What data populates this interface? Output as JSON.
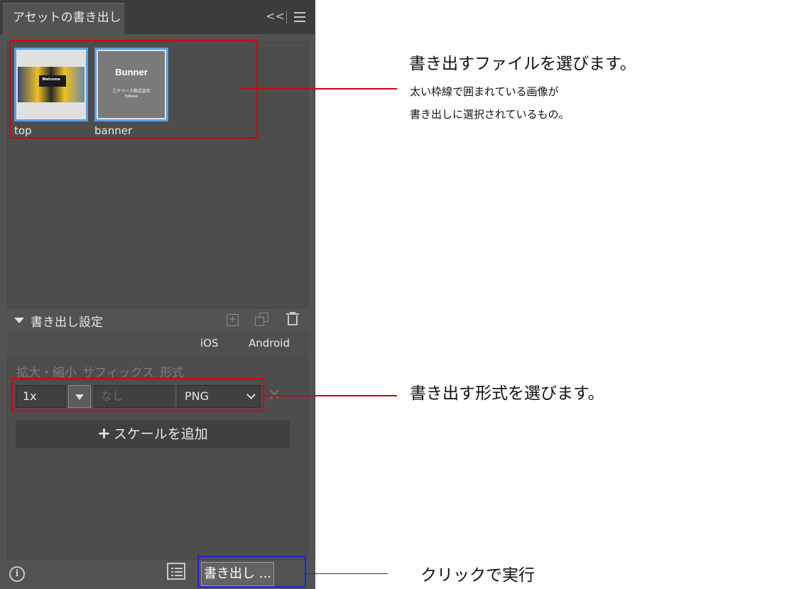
{
  "panel": {
    "tab_title": "アセットの書き出し",
    "collapse_icon": "<<"
  },
  "assets": [
    {
      "label": "top",
      "thumb_text": "Welcome"
    },
    {
      "label": "banner",
      "thumb_title": "Bunner",
      "thumb_sub1": "エドベース株式会社",
      "thumb_sub2": "Edbase"
    }
  ],
  "export_settings": {
    "title": "書き出し設定",
    "tabs": [
      "iOS",
      "Android"
    ],
    "column_headers": [
      "拡大・縮小",
      "サフィックス",
      "形式"
    ],
    "scale_value": "1x",
    "suffix_placeholder": "なし",
    "format_value": "PNG",
    "add_scale_label": "スケールを追加",
    "add_scale_plus": "+"
  },
  "footer": {
    "info_glyph": "i",
    "export_button": "書き出し ..."
  },
  "annotations": {
    "select_files_title": "書き出すファイルを選びます。",
    "select_files_line1": "太い枠線で囲まれている画像が",
    "select_files_line2": "書き出しに選択されているもの。",
    "select_format": "書き出す形式を選びます。",
    "click_execute": "クリックで実行"
  },
  "colors": {
    "panel_bg": "#535353",
    "selection_border": "#5aa0e6",
    "highlight_red": "#d9000f",
    "highlight_blue": "#2222d6"
  }
}
